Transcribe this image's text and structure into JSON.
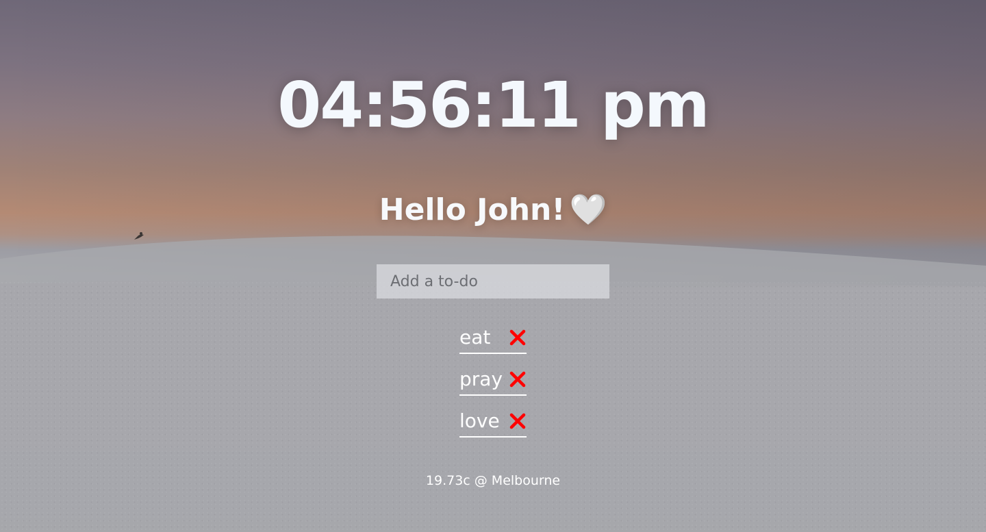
{
  "clock": {
    "time": "04:56:11 pm"
  },
  "greeting": {
    "text": "Hello John!",
    "emoji": "🤍"
  },
  "todo_input": {
    "placeholder": "Add a to-do",
    "value": ""
  },
  "todos": [
    {
      "text": "eat",
      "delete_icon": "close-icon"
    },
    {
      "text": "pray",
      "delete_icon": "close-icon"
    },
    {
      "text": "love",
      "delete_icon": "close-icon"
    }
  ],
  "weather": {
    "text": "19.73c @ Melbourne"
  },
  "colors": {
    "delete_icon": "#ff0000",
    "text": "#ffffff"
  }
}
